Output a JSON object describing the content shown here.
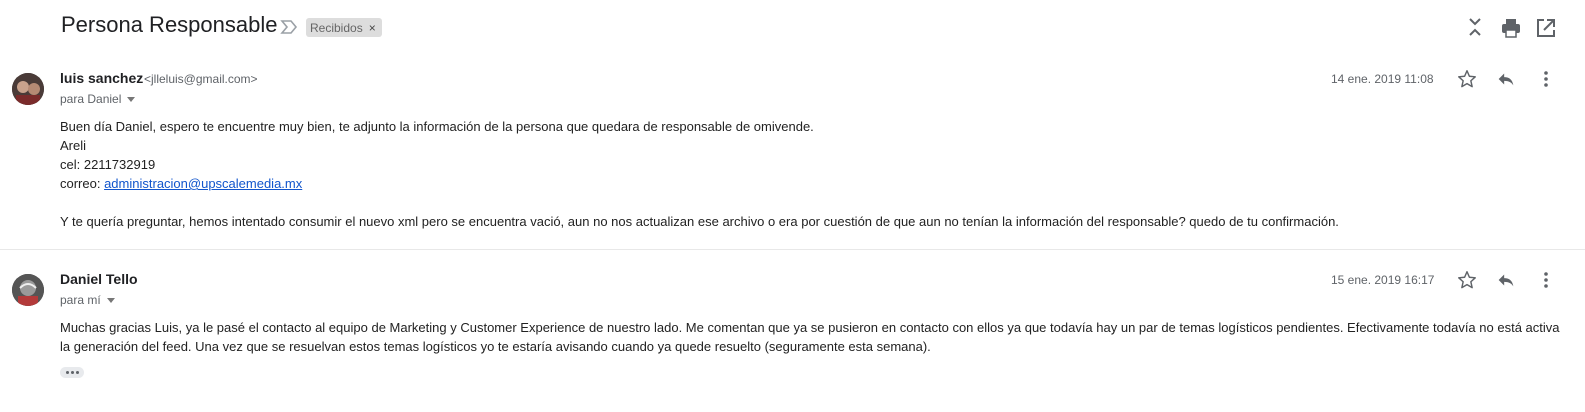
{
  "thread": {
    "subject": "Persona Responsable",
    "label": "Recibidos",
    "label_close": "×",
    "toolbar_icons": [
      "collapse-all-icon",
      "print-icon",
      "open-in-new-window-icon"
    ]
  },
  "messages": [
    {
      "sender_name": "luis sanchez",
      "sender_email": "<jlleluis@gmail.com>",
      "to": "para Daniel",
      "date": "14 ene. 2019 11:08",
      "body": {
        "greeting": "Buen día Daniel, espero te encuentre muy bien, te adjunto la información de la persona que quedara de responsable de omivende.",
        "name_line": "Areli",
        "phone_line": "cel: 2211732919",
        "email_prefix": "correo: ",
        "email_link": "administracion@upscalemedia.mx",
        "question": "Y te quería preguntar, hemos intentado consumir el nuevo xml pero se encuentra vació, aun no nos actualizan ese archivo o era por cuestión de que aun no tenían la información del responsable? quedo de tu confirmación."
      }
    },
    {
      "sender_name": "Daniel Tello",
      "to": "para mí",
      "date": "15 ene. 2019 16:17",
      "body": {
        "line1": "Muchas gracias Luis, ya le pasé el contacto al equipo de Marketing y Customer Experience de nuestro lado. Me comentan que ya se pusieron en contacto con ellos ya que todavía hay un par de temas logísticos pendientes. Efectivamente todavía no está activa",
        "line2": "la generación del feed.  Una vez que se resuelvan estos temas logísticos yo te estaría avisando cuando ya quede resuelto (seguramente esta semana)."
      }
    }
  ]
}
